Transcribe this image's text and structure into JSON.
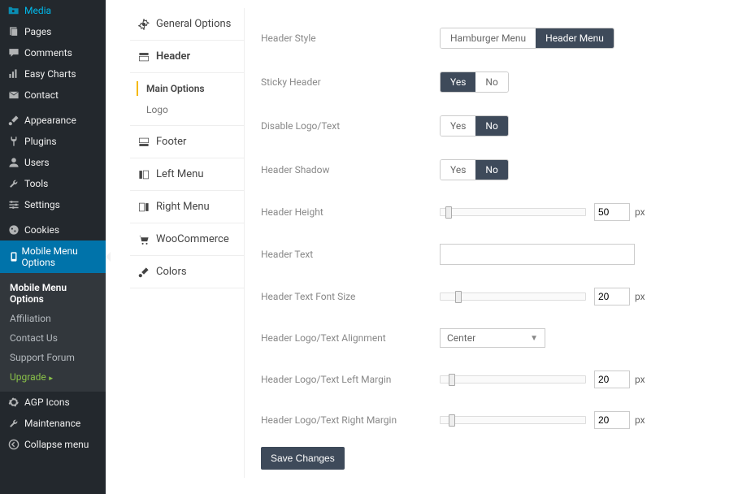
{
  "wp_menu": {
    "group1": [
      {
        "label": "Media",
        "icon": "media"
      },
      {
        "label": "Pages",
        "icon": "pages"
      },
      {
        "label": "Comments",
        "icon": "comments"
      },
      {
        "label": "Easy Charts",
        "icon": "chart"
      },
      {
        "label": "Contact",
        "icon": "mail"
      }
    ],
    "group2": [
      {
        "label": "Appearance",
        "icon": "brush"
      },
      {
        "label": "Plugins",
        "icon": "plug"
      },
      {
        "label": "Users",
        "icon": "user"
      },
      {
        "label": "Tools",
        "icon": "wrench"
      },
      {
        "label": "Settings",
        "icon": "sliders"
      }
    ],
    "group3": [
      {
        "label": "Cookies",
        "icon": "cookie"
      },
      {
        "label": "Mobile Menu Options",
        "icon": "mobile",
        "active": true
      }
    ],
    "submenu": [
      {
        "label": "Mobile Menu Options",
        "current": true
      },
      {
        "label": "Affiliation"
      },
      {
        "label": "Contact Us"
      },
      {
        "label": "Support Forum"
      },
      {
        "label": "Upgrade",
        "upgrade": true
      }
    ],
    "group4": [
      {
        "label": "AGP Icons",
        "icon": "gear"
      },
      {
        "label": "Maintenance",
        "icon": "wrench2"
      },
      {
        "label": "Collapse menu",
        "icon": "collapse"
      }
    ]
  },
  "tabs": [
    {
      "label": "General Options",
      "icon": "gear"
    },
    {
      "label": "Header",
      "icon": "header",
      "active": true,
      "sub": [
        {
          "label": "Main Options",
          "active": true
        },
        {
          "label": "Logo"
        }
      ]
    },
    {
      "label": "Footer",
      "icon": "footer"
    },
    {
      "label": "Left Menu",
      "icon": "leftmenu"
    },
    {
      "label": "Right Menu",
      "icon": "rightmenu"
    },
    {
      "label": "WooCommerce",
      "icon": "cart"
    },
    {
      "label": "Colors",
      "icon": "brush"
    }
  ],
  "form": {
    "header_style": {
      "label": "Header Style",
      "options": [
        "Hamburger Menu",
        "Header Menu"
      ],
      "value": "Header Menu"
    },
    "sticky": {
      "label": "Sticky Header",
      "options": [
        "Yes",
        "No"
      ],
      "value": "Yes"
    },
    "disable_logo": {
      "label": "Disable Logo/Text",
      "options": [
        "Yes",
        "No"
      ],
      "value": "No"
    },
    "shadow": {
      "label": "Header Shadow",
      "options": [
        "Yes",
        "No"
      ],
      "value": "No"
    },
    "height": {
      "label": "Header Height",
      "value": "50",
      "unit": "px"
    },
    "text": {
      "label": "Header Text",
      "value": ""
    },
    "fontsize": {
      "label": "Header Text Font Size",
      "value": "20",
      "unit": "px"
    },
    "align": {
      "label": "Header Logo/Text Alignment",
      "value": "Center"
    },
    "lmargin": {
      "label": "Header Logo/Text Left Margin",
      "value": "20",
      "unit": "px"
    },
    "rmargin": {
      "label": "Header Logo/Text Right Margin",
      "value": "20",
      "unit": "px"
    },
    "save": "Save Changes"
  }
}
